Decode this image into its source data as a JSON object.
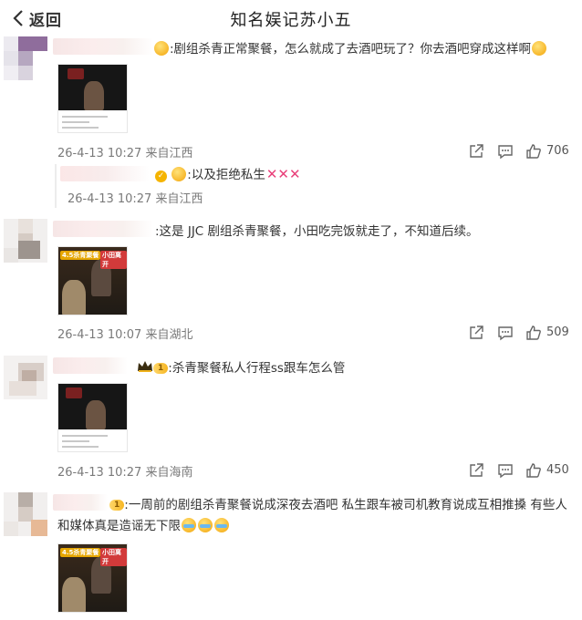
{
  "header": {
    "back_label": "返回",
    "title": "知名娱记苏小五"
  },
  "comments": [
    {
      "text": ":剧组杀青正常聚餐，怎么就成了去酒吧玩了？你去酒吧穿成这样啊",
      "date": "26-4-13 10:27",
      "location": "来自江西",
      "likes": "706",
      "reply": {
        "text": ":以及拒绝私生",
        "x_marks": "✕✕✕",
        "date": "26-4-13 10:27",
        "location": "来自江西"
      }
    },
    {
      "text": ":这是 JJC 剧组杀青聚餐，小田吃完饭就走了，不知道后续。",
      "date": "26-4-13 10:07",
      "location": "来自湖北",
      "likes": "509",
      "thumb_tags": [
        "4.5杀青聚餐",
        "小田离开"
      ]
    },
    {
      "level": "1",
      "text": ":杀青聚餐私人行程ss跟车怎么管",
      "date": "26-4-13 10:27",
      "location": "来自海南",
      "likes": "450"
    },
    {
      "level": "1",
      "text_line1": ":一周前的剧组杀青聚餐说成深夜去酒吧 私生跟车被司机教育说成互相推搡 有些人",
      "text_line2": "和媒体真是造谣无下限",
      "thumb_tags": [
        "4.5杀青聚餐",
        "小田离开"
      ]
    }
  ],
  "colors": {
    "accent_pink": "#e9407a",
    "meta_gray": "#7a7a7a",
    "badge_gold": "#f6b623"
  },
  "icons": [
    "chevron-left-icon",
    "share-icon",
    "comment-icon",
    "like-icon",
    "crown-icon",
    "verified-icon"
  ]
}
